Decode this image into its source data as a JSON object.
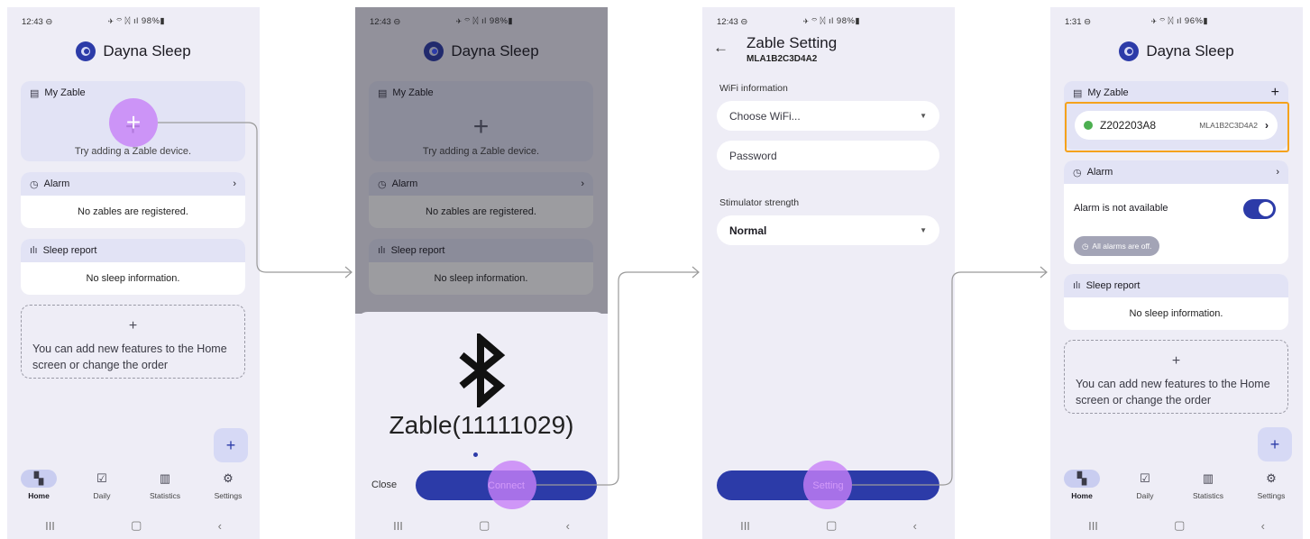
{
  "status1": {
    "time": "12:43 ⊖",
    "icons": "✈ ⌔ ᛞ ıl 98%▮"
  },
  "status4": {
    "time": "1:31 ⊖",
    "icons": "✈ ⌔ ᛞ ıl 96%▮"
  },
  "app": {
    "title": "Dayna Sleep"
  },
  "home": {
    "my_zable": "My Zable",
    "add_hint": "Try adding a Zable device.",
    "alarm": "Alarm",
    "no_zables": "No zables are registered.",
    "sleep_report": "Sleep report",
    "no_sleep": "No sleep information.",
    "add_features": "You can add new features to the Home screen or change the order",
    "alarm_unavailable": "Alarm is not available",
    "all_alarms_off": "All alarms are off."
  },
  "device": {
    "id": "Z202203A8",
    "mac": "MLA1B2C3D4A2"
  },
  "bottom_nav": [
    {
      "label": "Home",
      "icon": "▚"
    },
    {
      "label": "Daily",
      "icon": "☑"
    },
    {
      "label": "Statistics",
      "icon": "▥"
    },
    {
      "label": "Settings",
      "icon": "⚙"
    }
  ],
  "sys_nav": {
    "recent": "III",
    "home": "▢",
    "back": "‹"
  },
  "connect_sheet": {
    "device_name": "Zable(11111029)",
    "close": "Close",
    "connect": "Connect"
  },
  "zable_setting": {
    "title": "Zable Setting",
    "serial": "MLA1B2C3D4A2",
    "wifi_label": "WiFi information",
    "wifi_placeholder": "Choose WiFi...",
    "password_placeholder": "Password",
    "strength_label": "Stimulator strength",
    "strength_value": "Normal",
    "setting_button": "Setting"
  },
  "colors": {
    "accent": "#2c3ba8",
    "tap": "#c780f7",
    "highlight": "#f5a21b",
    "online": "#4caf50"
  }
}
